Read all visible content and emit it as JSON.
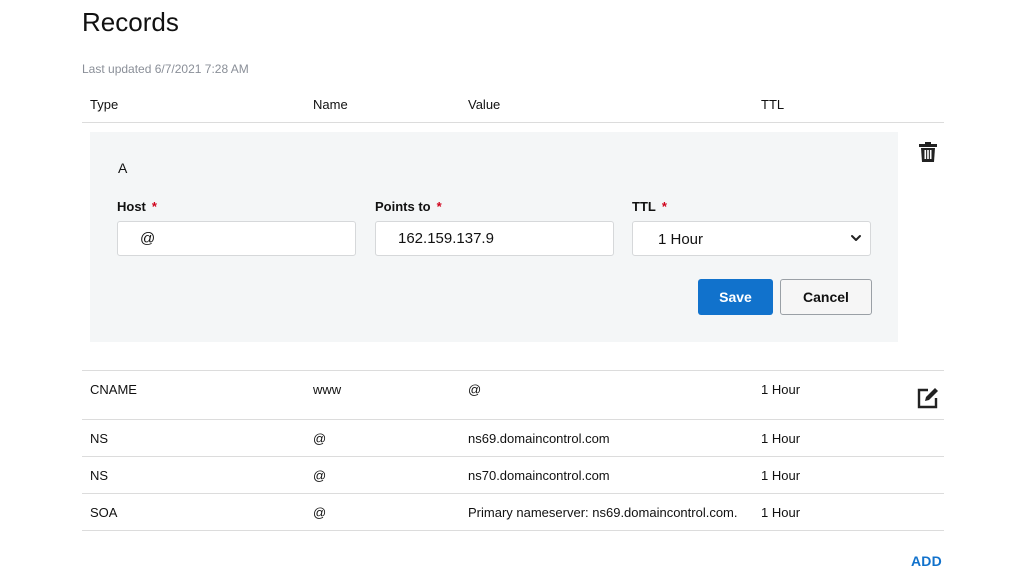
{
  "page": {
    "title": "Records",
    "last_updated": "Last updated 6/7/2021 7:28 AM"
  },
  "table": {
    "headers": {
      "type": "Type",
      "name": "Name",
      "value": "Value",
      "ttl": "TTL"
    },
    "rows": [
      {
        "type": "CNAME",
        "name": "www",
        "value": "@",
        "ttl": "1 Hour"
      },
      {
        "type": "NS",
        "name": "@",
        "value": "ns69.domaincontrol.com",
        "ttl": "1 Hour"
      },
      {
        "type": "NS",
        "name": "@",
        "value": "ns70.domaincontrol.com",
        "ttl": "1 Hour"
      },
      {
        "type": "SOA",
        "name": "@",
        "value": "Primary nameserver: ns69.domaincontrol.com.",
        "ttl": "1 Hour"
      }
    ]
  },
  "editor": {
    "record_type": "A",
    "host_label": "Host",
    "host_value": "@",
    "points_to_label": "Points to",
    "points_to_value": "162.159.137.9",
    "ttl_label": "TTL",
    "ttl_value": "1 Hour",
    "required_mark": "*",
    "save_label": "Save",
    "cancel_label": "Cancel"
  },
  "actions": {
    "add_label": "ADD"
  },
  "icons": {
    "delete": "trash-icon",
    "edit": "edit-icon",
    "select": "chevron-down-icon"
  },
  "colors": {
    "primary": "#1172cc",
    "required": "#d0021b",
    "panel_bg": "#f4f6f7",
    "muted_text": "#8a8f98"
  }
}
